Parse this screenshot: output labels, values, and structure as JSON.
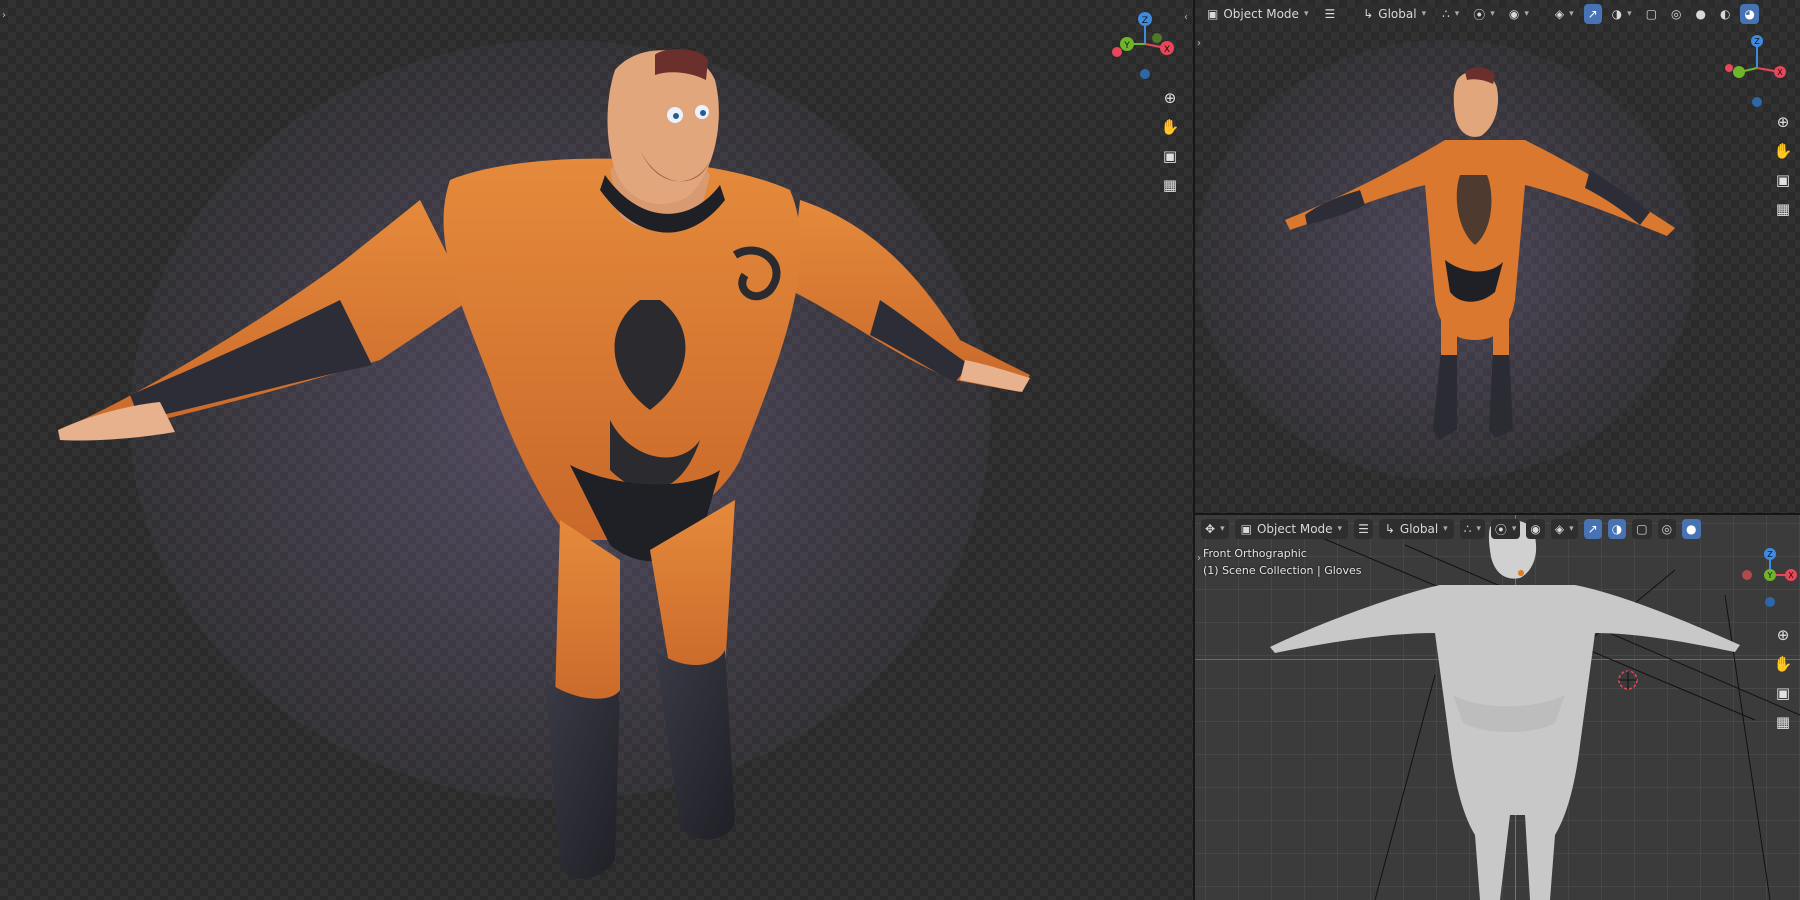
{
  "colors": {
    "suit_orange": "#d9782e",
    "suit_dark": "#2b2b33",
    "skin": "#e5b08a",
    "axis_x": "#e8465a",
    "axis_y": "#6fb52c",
    "axis_z": "#3f8be0",
    "active_button": "#4772b3"
  },
  "right_top_header": {
    "mode_label": "Object Mode",
    "transform_label": "Global"
  },
  "right_bottom_header": {
    "mode_label": "Object Mode",
    "transform_label": "Global"
  },
  "right_bottom_overlay": {
    "view_name": "Front Orthographic",
    "collection_info": "(1) Scene Collection | Gloves"
  },
  "gizmo_labels": {
    "x": "X",
    "y": "Y",
    "z": "Z"
  },
  "icons": [
    "zoom-icon",
    "hand-pan-icon",
    "camera-icon",
    "grid-ortho-icon",
    "menu-icon",
    "transform-orientation-icon",
    "snap-icon",
    "proportional-edit-icon",
    "visibility-icon",
    "gizmo-icon",
    "overlays-icon",
    "xray-icon",
    "shading-wireframe-icon",
    "shading-solid-icon",
    "shading-material-icon",
    "shading-rendered-icon"
  ]
}
